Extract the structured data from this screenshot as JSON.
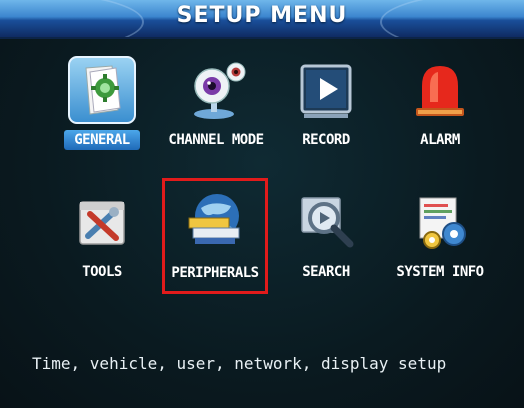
{
  "header": {
    "title": "SETUP  MENU"
  },
  "menu": {
    "items": [
      {
        "label": "GENERAL"
      },
      {
        "label": "CHANNEL MODE"
      },
      {
        "label": "RECORD"
      },
      {
        "label": "ALARM"
      },
      {
        "label": "TOOLS"
      },
      {
        "label": "PERIPHERALS"
      },
      {
        "label": "SEARCH"
      },
      {
        "label": "SYSTEM INFO"
      }
    ]
  },
  "status": {
    "text": "Time, vehicle, user, network, display setup"
  },
  "colors": {
    "title_bar": "#3c86cf",
    "focus_border": "#e11b1b",
    "selected_label": "#2b82cf"
  }
}
